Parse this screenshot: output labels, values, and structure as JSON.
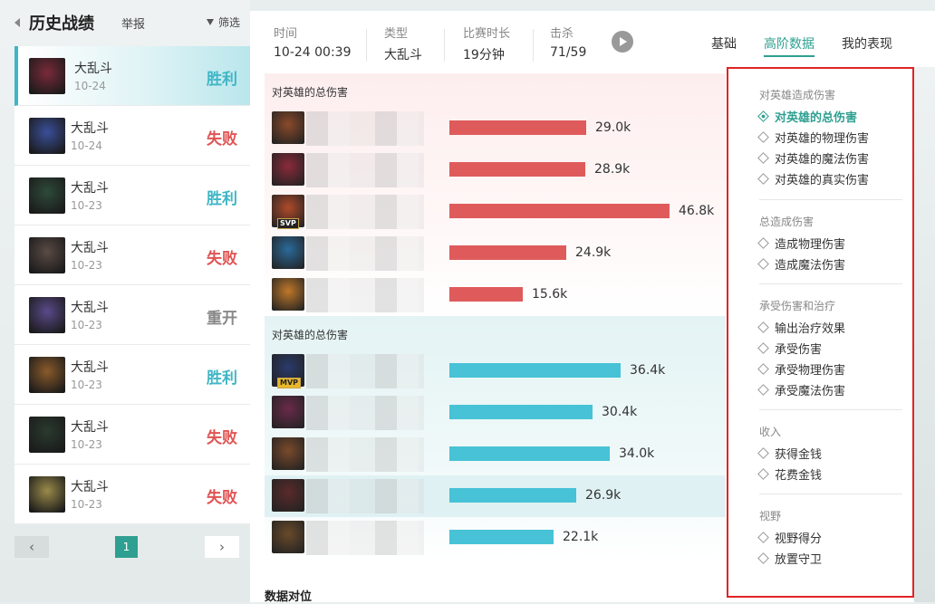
{
  "sidebar": {
    "title": "历史战绩",
    "report_label": "举报",
    "filter_label": "筛选",
    "matches": [
      {
        "mode": "大乱斗",
        "date": "10-24",
        "result": "胜利",
        "result_type": "win",
        "avatar_color": "#7a2a3a"
      },
      {
        "mode": "大乱斗",
        "date": "10-24",
        "result": "失败",
        "result_type": "lose",
        "avatar_color": "#3a4f9a"
      },
      {
        "mode": "大乱斗",
        "date": "10-23",
        "result": "胜利",
        "result_type": "win",
        "avatar_color": "#2e4a3a"
      },
      {
        "mode": "大乱斗",
        "date": "10-23",
        "result": "失败",
        "result_type": "lose",
        "avatar_color": "#5a4a44"
      },
      {
        "mode": "大乱斗",
        "date": "10-23",
        "result": "重开",
        "result_type": "remake",
        "avatar_color": "#5a4a8a"
      },
      {
        "mode": "大乱斗",
        "date": "10-23",
        "result": "胜利",
        "result_type": "win",
        "avatar_color": "#8a5a2a"
      },
      {
        "mode": "大乱斗",
        "date": "10-23",
        "result": "失败",
        "result_type": "lose",
        "avatar_color": "#2a3a2e"
      },
      {
        "mode": "大乱斗",
        "date": "10-23",
        "result": "失败",
        "result_type": "lose",
        "avatar_color": "#9a8a4a"
      }
    ],
    "pager": {
      "prev": "‹",
      "page": "1",
      "next": "›"
    }
  },
  "header": {
    "time_label": "时间",
    "time_value": "10-24 00:39",
    "type_label": "类型",
    "type_value": "大乱斗",
    "duration_label": "比赛时长",
    "duration_value": "19分钟",
    "kills_label": "击杀",
    "kills_value": "71/59",
    "tabs": [
      "基础",
      "高阶数据",
      "我的表现"
    ]
  },
  "red_team": {
    "label": "对英雄的总伤害",
    "players": [
      {
        "value": 29.0,
        "label": "29.0k",
        "color": "#8a4a2a",
        "badge": ""
      },
      {
        "value": 28.9,
        "label": "28.9k",
        "color": "#8a2a3a",
        "badge": ""
      },
      {
        "value": 46.8,
        "label": "46.8k",
        "color": "#b04a2a",
        "badge": "SVP"
      },
      {
        "value": 24.9,
        "label": "24.9k",
        "color": "#2a6a9a",
        "badge": ""
      },
      {
        "value": 15.6,
        "label": "15.6k",
        "color": "#c0782a",
        "badge": ""
      }
    ]
  },
  "blue_team": {
    "label": "对英雄的总伤害",
    "players": [
      {
        "value": 36.4,
        "label": "36.4k",
        "color": "#2a3a6a",
        "badge": "MVP"
      },
      {
        "value": 30.4,
        "label": "30.4k",
        "color": "#6a2a4a",
        "badge": ""
      },
      {
        "value": 34.0,
        "label": "34.0k",
        "color": "#7a4a2a",
        "badge": ""
      },
      {
        "value": 26.9,
        "label": "26.9k",
        "color": "#5a2a2a",
        "badge": ""
      },
      {
        "value": 22.1,
        "label": "22.1k",
        "color": "#6a4a2a",
        "badge": ""
      }
    ]
  },
  "bottom_title": "数据对位",
  "panel": {
    "groups": [
      {
        "title": "对英雄造成伤害",
        "options": [
          "对英雄的总伤害",
          "对英雄的物理伤害",
          "对英雄的魔法伤害",
          "对英雄的真实伤害"
        ]
      },
      {
        "title": "总造成伤害",
        "options": [
          "造成物理伤害",
          "造成魔法伤害"
        ]
      },
      {
        "title": "承受伤害和治疗",
        "options": [
          "输出治疗效果",
          "承受伤害",
          "承受物理伤害",
          "承受魔法伤害"
        ]
      },
      {
        "title": "收入",
        "options": [
          "获得金钱",
          "花费金钱"
        ]
      },
      {
        "title": "视野",
        "options": [
          "视野得分",
          "放置守卫"
        ]
      }
    ],
    "selected": "对英雄的总伤害"
  },
  "colors": {
    "accent": "#2e9f90",
    "win": "#3fb6c6",
    "lose": "#e05454",
    "red_bar": "#df5b5b",
    "blue_bar": "#47c2d6",
    "highlight_border": "#e02424"
  }
}
